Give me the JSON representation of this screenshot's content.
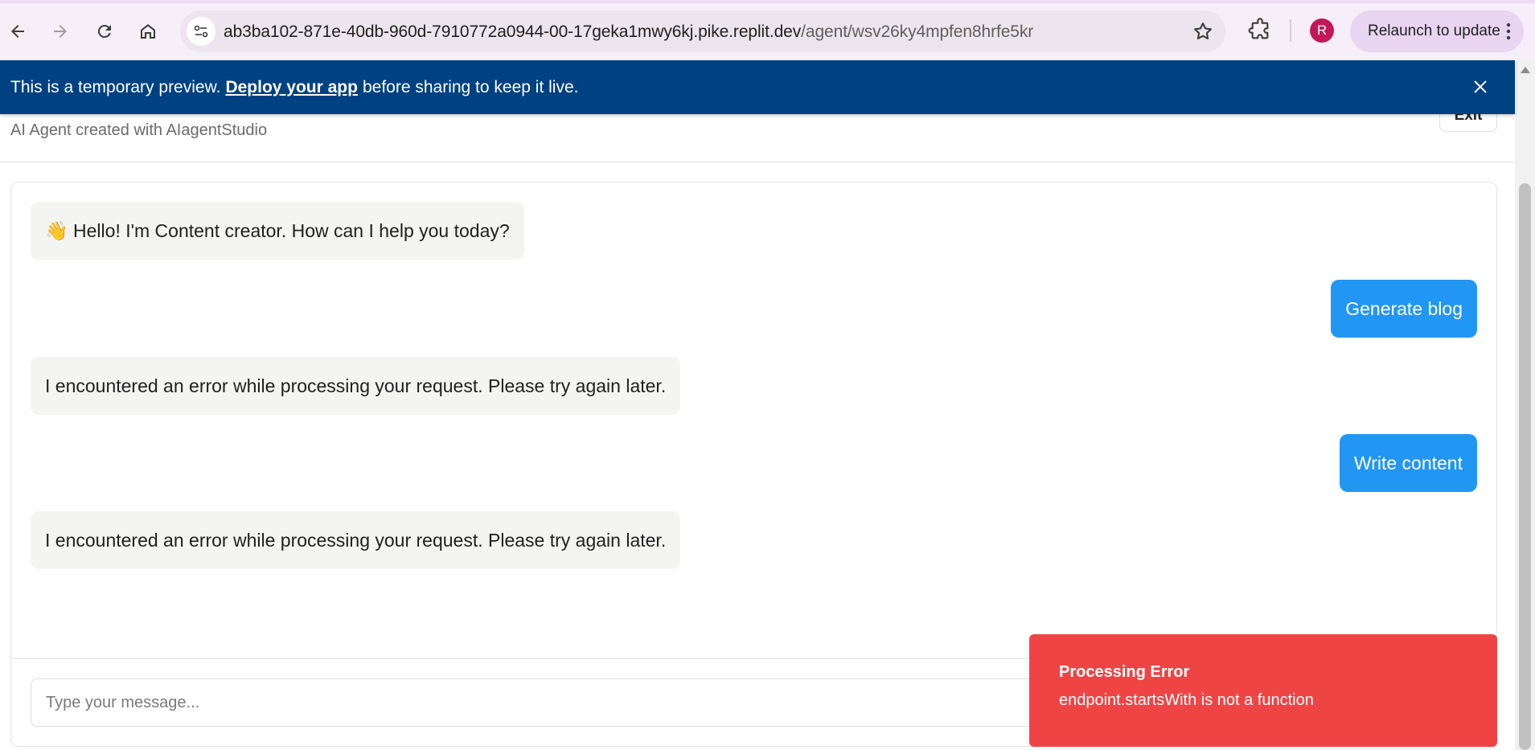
{
  "browser": {
    "url_host": "ab3ba102-871e-40db-960d-7910772a0944-00-17geka1mwy6kj.pike.replit.dev",
    "url_path": "/agent/wsv26ky4mpfen8hrfe5kr",
    "profile_initial": "R",
    "relaunch_label": "Relaunch to update",
    "icons": [
      "back-icon",
      "forward-icon",
      "reload-icon",
      "home-icon",
      "site-settings-icon",
      "bookmark-star-icon",
      "extensions-icon",
      "more-menu-icon"
    ]
  },
  "banner": {
    "text_before": "This is a temporary preview.",
    "link": "Deploy your app",
    "text_after": "before sharing to keep it live."
  },
  "header": {
    "subtitle": "AI Agent created with AIagentStudio",
    "exit_label": "Exit"
  },
  "chat": {
    "messages": [
      {
        "role": "bot",
        "text": "👋 Hello! I'm Content creator. How can I help you today?"
      },
      {
        "role": "user",
        "text": "Generate blog"
      },
      {
        "role": "bot",
        "text": "I encountered an error while processing your request. Please try again later."
      },
      {
        "role": "user",
        "text": "Write content"
      },
      {
        "role": "bot",
        "text": "I encountered an error while processing your request. Please try again later."
      }
    ],
    "input_placeholder": "Type your message..."
  },
  "toast": {
    "title": "Processing Error",
    "description": "endpoint.startsWith is not a function"
  },
  "colors": {
    "banner_bg": "#004182",
    "user_bubble": "#2196f3",
    "bot_bubble": "#f4f4f2",
    "toast_bg": "#ef4444"
  }
}
